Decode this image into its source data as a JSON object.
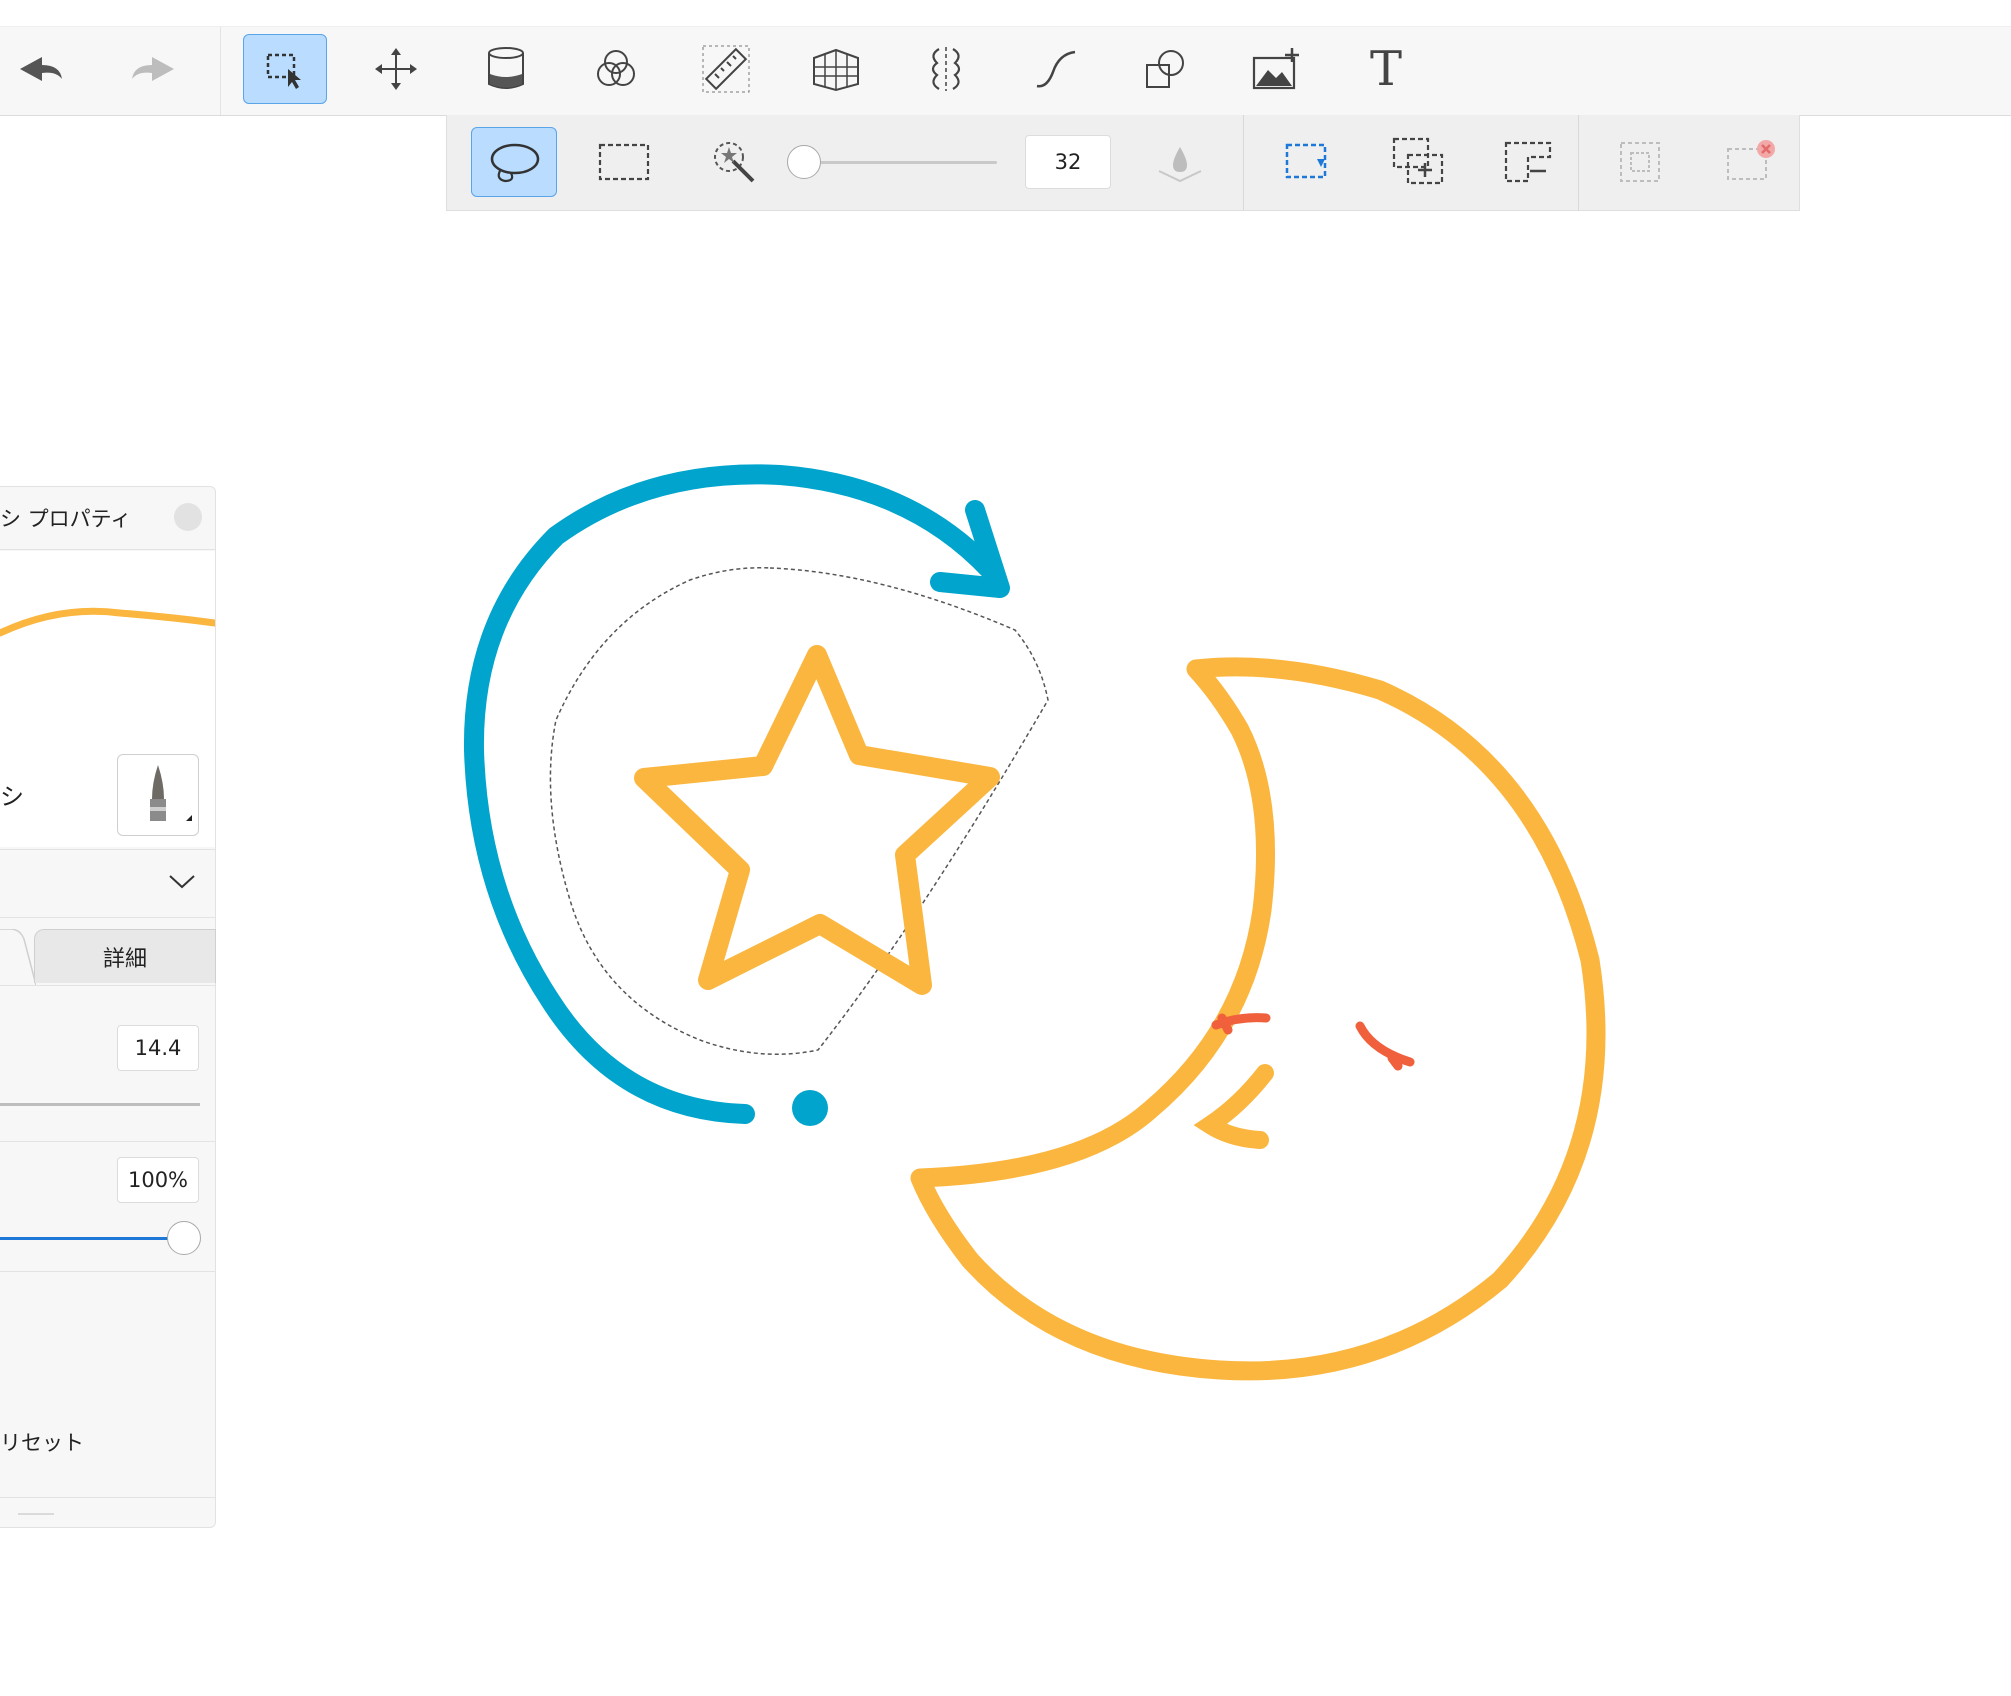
{
  "main_toolbar": {
    "tools": [
      {
        "name": "undo",
        "icon": "undo-icon"
      },
      {
        "name": "redo",
        "icon": "redo-icon",
        "disabled": true
      },
      {
        "name": "selection",
        "icon": "selection-icon",
        "active": true
      },
      {
        "name": "transform",
        "icon": "move-icon"
      },
      {
        "name": "fill",
        "icon": "paint-bucket-icon"
      },
      {
        "name": "color-blend",
        "icon": "color-circles-icon"
      },
      {
        "name": "ruler",
        "icon": "ruler-icon"
      },
      {
        "name": "perspective",
        "icon": "perspective-grid-icon"
      },
      {
        "name": "symmetry",
        "icon": "symmetry-icon"
      },
      {
        "name": "curve",
        "icon": "curve-icon"
      },
      {
        "name": "shapes",
        "icon": "shapes-icon"
      },
      {
        "name": "insert-image",
        "icon": "insert-image-icon"
      },
      {
        "name": "text",
        "icon": "text-icon",
        "glyph": "T"
      }
    ]
  },
  "selection_toolbar": {
    "modes": [
      "lasso-select-icon",
      "rect-select-icon",
      "magic-wand-icon"
    ],
    "active_mode": "lasso-select-icon",
    "tolerance_value": "32",
    "tolerance_fraction": 0.1,
    "actions": [
      "select-new-icon",
      "select-add-icon",
      "select-subtract-icon",
      "select-invert-icon",
      "select-clear-icon"
    ]
  },
  "brush_panel": {
    "title": "シ プロパティ",
    "brush_label": "シ",
    "tab_detail": "詳細",
    "size_value": "14.4",
    "opacity_value": "100%",
    "opacity_fraction": 1.0,
    "reset_label": "リセット"
  },
  "colors": {
    "accent_blue": "#1e78d7",
    "active_bg": "#b9dcff",
    "drawing_orange": "#fbb63f",
    "drawing_blue": "#00a4cc",
    "drawing_red": "#f0603c"
  }
}
